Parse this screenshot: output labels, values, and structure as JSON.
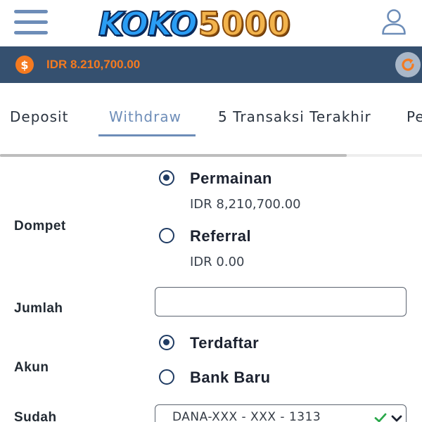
{
  "header": {
    "logo_part1": "KOKO",
    "logo_part2": "5000",
    "menu_icon": "hamburger-menu-icon",
    "user_icon": "user-icon"
  },
  "balance": {
    "currency_icon": "dollar-icon",
    "text": "IDR 8.210,700.00",
    "refresh_icon": "refresh-icon",
    "accent_color": "#f47a20",
    "bar_color": "#35506f"
  },
  "tabs": [
    {
      "label": "Deposit",
      "active": false
    },
    {
      "label": "Withdraw",
      "active": true
    },
    {
      "label": "5 Transaksi Terakhir",
      "active": false
    },
    {
      "label": "Pe",
      "active": false
    }
  ],
  "form": {
    "dompet": {
      "label": "Dompet",
      "options": [
        {
          "label": "Permainan",
          "amount": "IDR 8,210,700.00",
          "checked": true
        },
        {
          "label": "Referral",
          "amount": "IDR 0.00",
          "checked": false
        }
      ]
    },
    "jumlah": {
      "label": "Jumlah",
      "value": "",
      "placeholder": ""
    },
    "akun": {
      "label": "Akun",
      "options": [
        {
          "label": "Terdaftar",
          "checked": true
        },
        {
          "label": "Bank Baru",
          "checked": false
        }
      ]
    },
    "sudah": {
      "label": "Sudah",
      "selected": "DANA-XXX - XXX - 1313"
    }
  },
  "colors": {
    "tab_active": "#6d8db8",
    "radio": "#1f3b63"
  }
}
